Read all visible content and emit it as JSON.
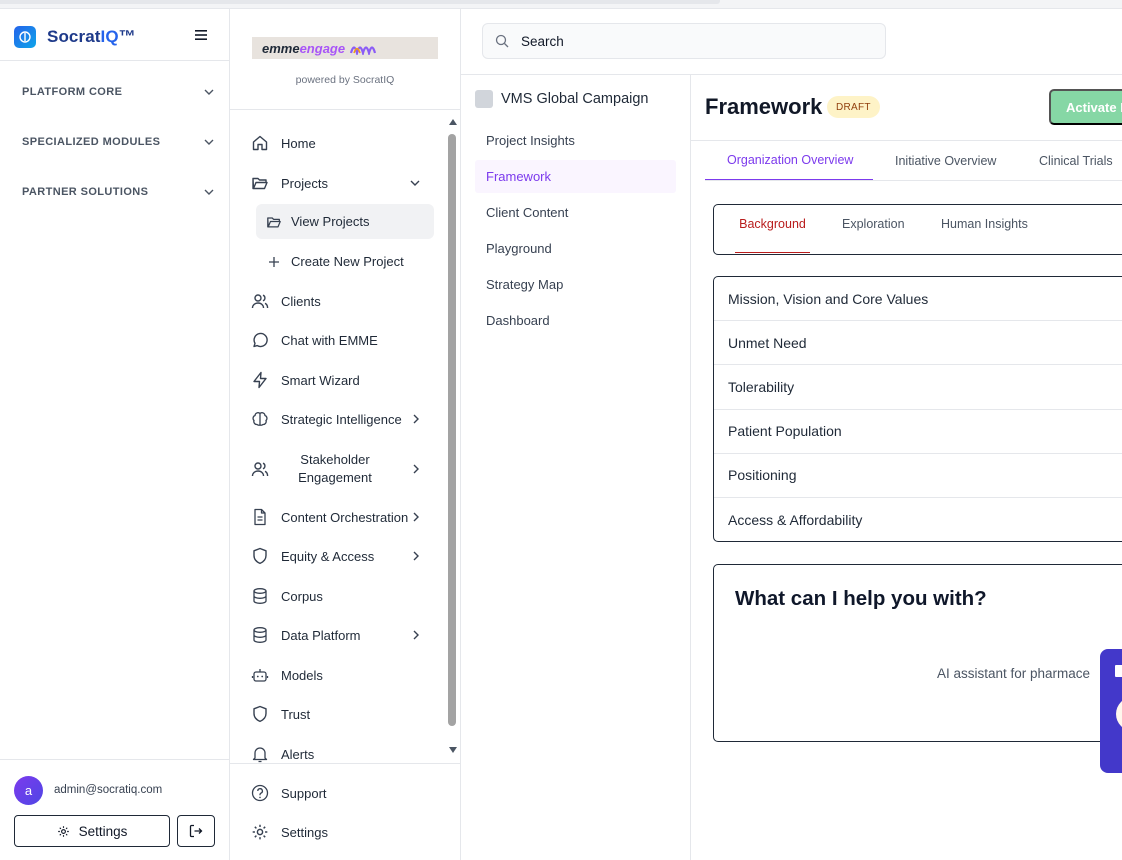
{
  "app": {
    "brand_prefix": "Socrat",
    "brand_highlight": "IQ",
    "brand_suffix": "™"
  },
  "platform_sections": [
    {
      "label": "PLATFORM CORE"
    },
    {
      "label": "SPECIALIZED MODULES"
    },
    {
      "label": "PARTNER SOLUTIONS"
    }
  ],
  "user": {
    "avatar_letter": "a",
    "email": "admin@socratiq.com",
    "settings_label": "Settings"
  },
  "emme": {
    "logo_text_1": "emme",
    "logo_text_2": "engage",
    "powered_by": "powered by SocratIQ"
  },
  "nav": {
    "home": "Home",
    "projects": "Projects",
    "view_projects": "View Projects",
    "create_new_project": "Create New Project",
    "clients": "Clients",
    "chat_with_emme": "Chat with EMME",
    "smart_wizard": "Smart Wizard",
    "strategic_intelligence": "Strategic Intelligence",
    "stakeholder_engagement": "Stakeholder Engagement",
    "content_orchestration": "Content Orchestration",
    "equity_access": "Equity & Access",
    "corpus": "Corpus",
    "data_platform": "Data Platform",
    "models": "Models",
    "trust": "Trust",
    "alerts": "Alerts",
    "support": "Support",
    "settings": "Settings"
  },
  "search": {
    "placeholder": "Search"
  },
  "project": {
    "name": "VMS Global Campaign",
    "sections": [
      {
        "label": "Project Insights"
      },
      {
        "label": "Framework"
      },
      {
        "label": "Client Content"
      },
      {
        "label": "Playground"
      },
      {
        "label": "Strategy Map"
      },
      {
        "label": "Dashboard"
      }
    ]
  },
  "framework": {
    "title": "Framework",
    "status_badge": "DRAFT",
    "activate_label": "Activate P",
    "tabs": [
      {
        "label": "Organization Overview"
      },
      {
        "label": "Initiative Overview"
      },
      {
        "label": "Clinical Trials"
      }
    ],
    "inner_tabs": [
      {
        "label": "Background"
      },
      {
        "label": "Exploration"
      },
      {
        "label": "Human Insights"
      }
    ],
    "sections": [
      {
        "label": "Mission, Vision and Core Values"
      },
      {
        "label": "Unmet Need"
      },
      {
        "label": "Tolerability"
      },
      {
        "label": "Patient Population"
      },
      {
        "label": "Positioning"
      },
      {
        "label": "Access & Affordability"
      }
    ]
  },
  "assistant": {
    "title": "What can I help you with?",
    "subtitle": "AI assistant for pharmace"
  },
  "colors": {
    "brand": "#1e3a8a",
    "accent_purple": "#7c3aed",
    "inner_tab_active": "#b91c1c",
    "draft_bg": "#fef3c7",
    "activate_bg": "#86d7a5",
    "widget_bg": "#4338ca"
  }
}
